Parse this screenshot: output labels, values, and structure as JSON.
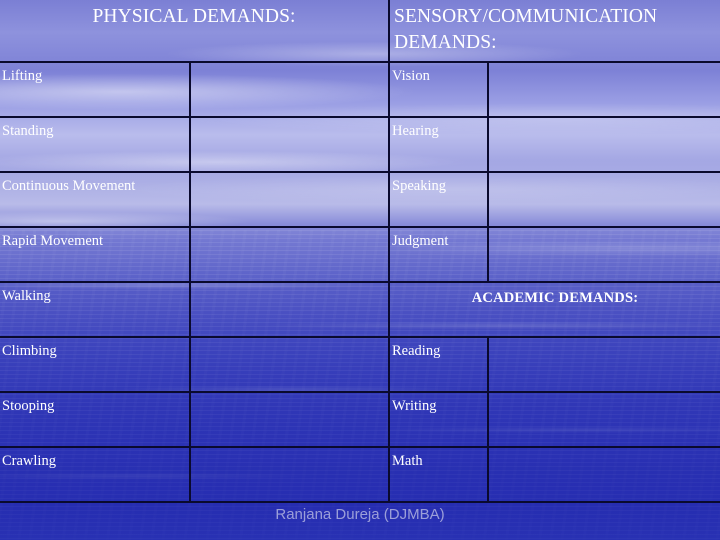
{
  "slide": {
    "background_top_color": "#8e92dd",
    "background_bottom_color": "#262db1",
    "border_color": "#0a0a2e",
    "text_color": "#ffffff"
  },
  "table": {
    "headers": {
      "left": "PHYSICAL DEMANDS:",
      "right": "SENSORY/COMMUNICATION DEMANDS:"
    },
    "subheaders": {
      "academic": "ACADEMIC DEMANDS:"
    },
    "rows": [
      {
        "left": "Lifting",
        "left_value": "",
        "right": "Vision",
        "right_value": ""
      },
      {
        "left": "Standing",
        "left_value": "",
        "right": "Hearing",
        "right_value": ""
      },
      {
        "left": "Continuous Movement",
        "left_value": "",
        "right": "Speaking",
        "right_value": ""
      },
      {
        "left": "Rapid Movement",
        "left_value": "",
        "right": "Judgment",
        "right_value": ""
      },
      {
        "left": "Walking",
        "left_value": "",
        "right": "ACADEMIC DEMANDS:",
        "right_value": ""
      },
      {
        "left": "Climbing",
        "left_value": "",
        "right": "Reading",
        "right_value": ""
      },
      {
        "left": "Stooping",
        "left_value": "",
        "right": "Writing",
        "right_value": ""
      },
      {
        "left": "Crawling",
        "left_value": "",
        "right": "Math",
        "right_value": ""
      }
    ]
  },
  "footer": {
    "credit": "Ranjana Dureja (DJMBA)"
  }
}
